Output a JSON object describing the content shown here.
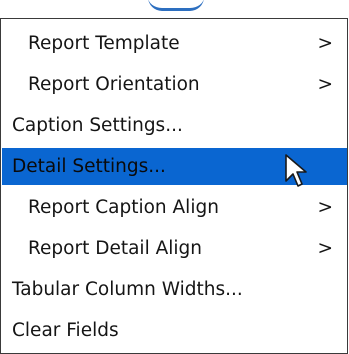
{
  "menu": {
    "items": [
      {
        "label": "Report Template",
        "arrow": ">",
        "indent": true,
        "selected": false
      },
      {
        "label": "Report Orientation",
        "arrow": ">",
        "indent": true,
        "selected": false
      },
      {
        "label": "Caption Settings...",
        "arrow": "",
        "indent": false,
        "selected": false
      },
      {
        "label": "Detail Settings...",
        "arrow": "",
        "indent": false,
        "selected": true
      },
      {
        "label": "Report Caption Align",
        "arrow": ">",
        "indent": true,
        "selected": false
      },
      {
        "label": "Report Detail Align",
        "arrow": ">",
        "indent": true,
        "selected": false
      },
      {
        "label": "Tabular Column Widths...",
        "arrow": "",
        "indent": false,
        "selected": false
      },
      {
        "label": "Clear Fields",
        "arrow": "",
        "indent": false,
        "selected": false
      }
    ]
  },
  "colors": {
    "selection": "#0a66d1",
    "text": "#151515",
    "border": "#3a3a3a"
  },
  "icons": {
    "cursor": "mouse-pointer-icon",
    "submenu": "submenu-arrow"
  }
}
